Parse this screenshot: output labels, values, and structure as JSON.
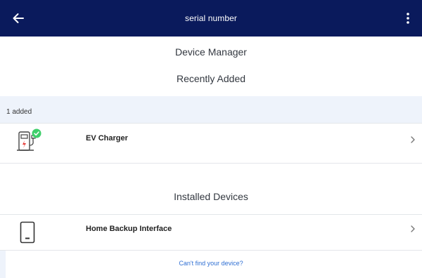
{
  "header": {
    "title": "serial number",
    "back_icon": "arrow-left-icon",
    "menu_icon": "more-vertical-icon",
    "background": "#0a1a5c"
  },
  "device_manager": {
    "title": "Device Manager",
    "recently_added_title": "Recently Added",
    "added_count": "1 added",
    "recent_items": [
      {
        "label": "EV Charger",
        "icon": "ev-charger-icon",
        "status_icon": "check-badge-icon"
      }
    ],
    "installed_title": "Installed Devices",
    "installed_items": [
      {
        "label": "Home Backup Interface",
        "icon": "backup-interface-icon"
      }
    ],
    "footer_link": "Can't find your device?"
  },
  "colors": {
    "accent": "#2f6fd3",
    "success": "#3ecf6a",
    "band": "#eef3fb",
    "alert": "#e53935"
  }
}
